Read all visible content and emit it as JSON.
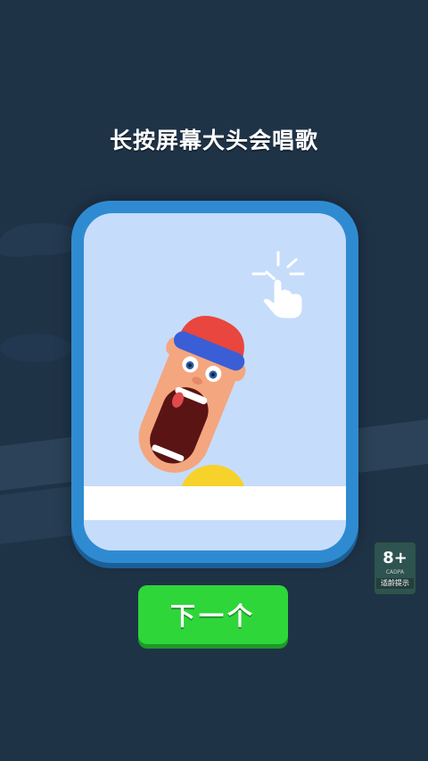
{
  "hint": {
    "text": "长按屏幕大头会唱歌"
  },
  "next_button": {
    "label": "下一个"
  },
  "age_badge": {
    "rating": "8+",
    "sub": "CADPA",
    "tip": "适龄提示"
  },
  "colors": {
    "background": "#1f3347",
    "card_frame": "#2f8bd1",
    "card_inner": "#c6dcfb",
    "button": "#2fd63a",
    "sun": "#f6d22a",
    "hat_band": "#3a5ed6",
    "hat_top": "#e8463e"
  },
  "icons": [
    "tap-hand-icon",
    "singing-head-character",
    "sun-shape"
  ]
}
